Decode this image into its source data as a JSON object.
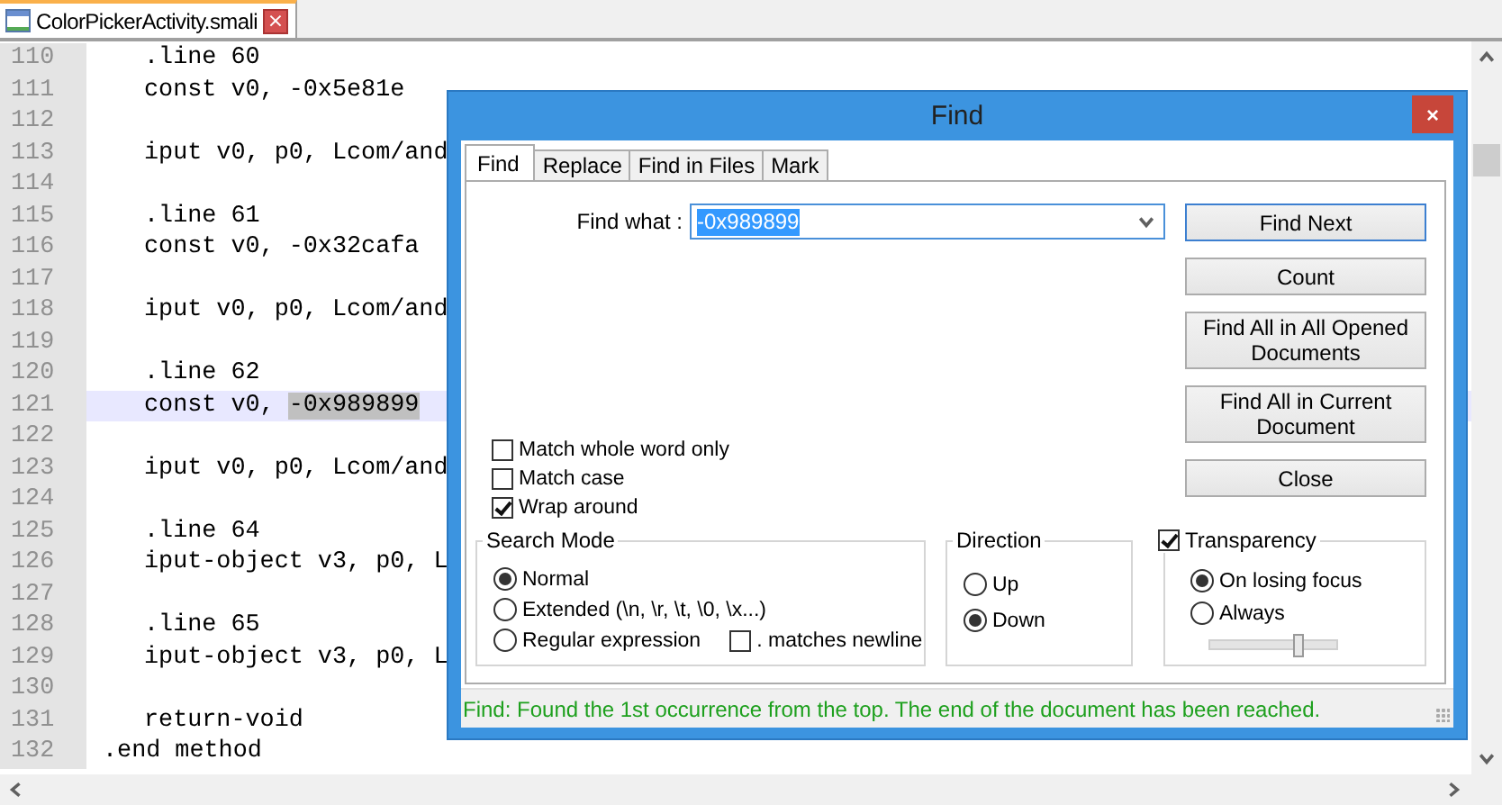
{
  "file_tab": {
    "title": "ColorPickerActivity.smali",
    "close": "×"
  },
  "editor": {
    "lines": [
      {
        "number": "110",
        "text": ".line 60",
        "kind": "indented"
      },
      {
        "number": "111",
        "text": "const v0, -0x5e81e",
        "kind": "indented"
      },
      {
        "number": "112",
        "kind": "indented"
      },
      {
        "number": "113",
        "text": "iput v0, p0, Lcom/and",
        "kind": "indented"
      },
      {
        "number": "114",
        "kind": "indented"
      },
      {
        "number": "115",
        "text": ".line 61",
        "kind": "indented"
      },
      {
        "number": "116",
        "text": "const v0, -0x32cafa",
        "kind": "indented"
      },
      {
        "number": "117",
        "kind": "indented"
      },
      {
        "number": "118",
        "text": "iput v0, p0, Lcom/and",
        "kind": "indented"
      },
      {
        "number": "119",
        "kind": "indented"
      },
      {
        "number": "120",
        "text": ".line 62",
        "kind": "indented"
      },
      {
        "number": "121",
        "text": "const v0, ",
        "match": "-0x989899",
        "kind": "indented",
        "current": true
      },
      {
        "number": "122",
        "kind": "indented"
      },
      {
        "number": "123",
        "text": "iput v0, p0, Lcom/and",
        "kind": "indented"
      },
      {
        "number": "124",
        "kind": "indented"
      },
      {
        "number": "125",
        "text": ".line 64",
        "kind": "indented"
      },
      {
        "number": "126",
        "text": "iput-object v3, p0, L",
        "kind": "indented"
      },
      {
        "number": "127",
        "kind": "indented"
      },
      {
        "number": "128",
        "text": ".line 65",
        "kind": "indented"
      },
      {
        "number": "129",
        "text": "iput-object v3, p0, L",
        "kind": "indented"
      },
      {
        "number": "130",
        "kind": "indented"
      },
      {
        "number": "131",
        "text": "return-void",
        "kind": "indented"
      },
      {
        "number": "132",
        "text": ".end method",
        "kind": "plain"
      }
    ]
  },
  "dialog": {
    "title": "Find",
    "close": "×",
    "tabs": [
      {
        "label": "Find",
        "selected": true
      },
      {
        "label": "Replace",
        "selected": false
      },
      {
        "label": "Find in Files",
        "selected": false
      },
      {
        "label": "Mark",
        "selected": false
      }
    ],
    "find_what": {
      "label": "Find what :",
      "value": "-0x989899"
    },
    "buttons": [
      {
        "label": "Find Next",
        "default": true
      },
      {
        "label": "Count",
        "default": false
      },
      {
        "label": "Find All in All Opened Documents",
        "default": false
      },
      {
        "label": "Find All in Current Document",
        "default": false
      },
      {
        "label": "Close",
        "default": false
      }
    ],
    "options": [
      {
        "label": "Match whole word only",
        "checked": false
      },
      {
        "label": "Match case",
        "checked": false
      },
      {
        "label": "Wrap around",
        "checked": true
      }
    ],
    "search_mode": {
      "title": "Search Mode",
      "modes": [
        {
          "label": "Normal",
          "selected": true
        },
        {
          "label": "Extended (\\n, \\r, \\t, \\0, \\x...)",
          "selected": false
        },
        {
          "label": "Regular expression",
          "selected": false
        }
      ],
      "dot_matches_newline": {
        "label": ". matches newline",
        "checked": false
      }
    },
    "direction": {
      "title": "Direction",
      "options": [
        {
          "label": "Up",
          "selected": false
        },
        {
          "label": "Down",
          "selected": true
        }
      ]
    },
    "transparency": {
      "label": "Transparency",
      "checked": true,
      "options": [
        {
          "label": "On losing focus",
          "selected": true
        },
        {
          "label": "Always",
          "selected": false
        }
      ],
      "level": 0.7
    },
    "status": "Find: Found the 1st occurrence from the top. The end of the document has been reached."
  }
}
